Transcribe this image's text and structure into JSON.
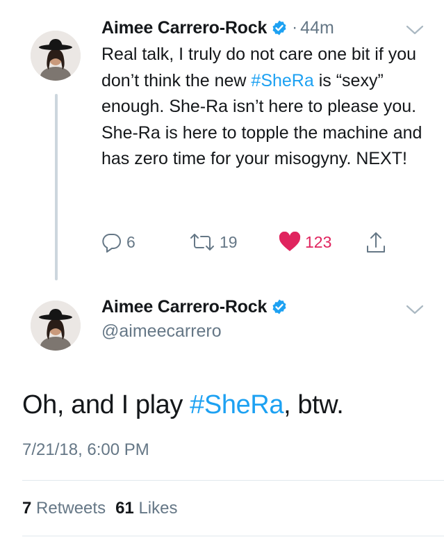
{
  "reply_tweet": {
    "author_name": "Aimee Carrero-Rock",
    "separator": "·",
    "time_ago": "44m",
    "body_parts": [
      {
        "text": "Real talk, I truly do not care one bit if you don’t think the new ",
        "type": "text"
      },
      {
        "text": "#SheRa",
        "type": "hashtag"
      },
      {
        "text": " is “sexy” enough. She-Ra isn’t here to please you. She-Ra is here to topple the machine and has zero time for your misogyny. NEXT!",
        "type": "text"
      }
    ],
    "actions": {
      "replies": "6",
      "retweets": "19",
      "likes": "123"
    }
  },
  "main_tweet": {
    "author_name": "Aimee Carrero-Rock",
    "handle": "@aimeecarrero",
    "text_before": "Oh, and I play ",
    "hashtag": "#SheRa",
    "text_after": ", btw.",
    "timestamp": "7/21/18, 6:00 PM",
    "retweet_count": "7",
    "retweet_label": "Retweets",
    "like_count": "61",
    "like_label": "Likes"
  },
  "colors": {
    "accent": "#1da1f2",
    "like": "#e0245e",
    "secondary_text": "#657786"
  }
}
